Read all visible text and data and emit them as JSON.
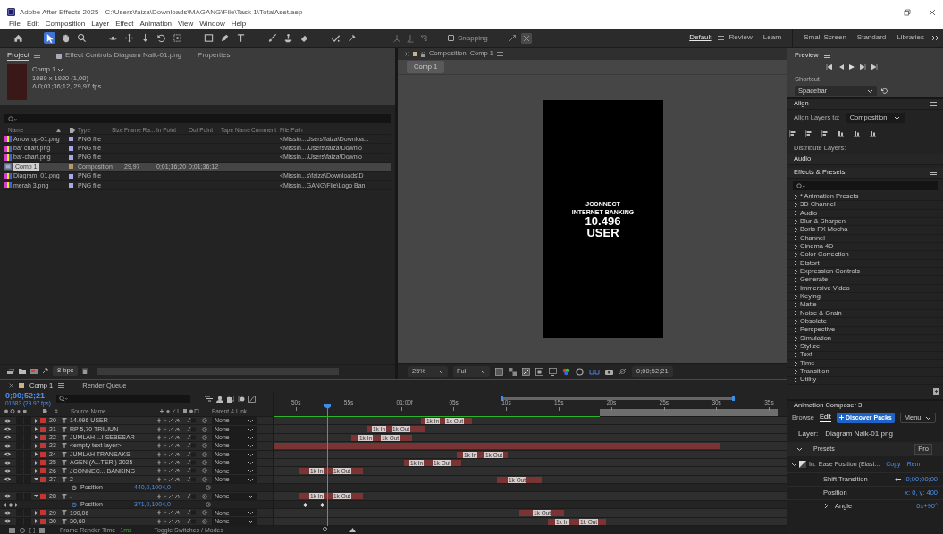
{
  "window": {
    "title": "Adobe After Effects 2025 - C:\\Users\\faiza\\Downloads\\MAGANG\\File\\Task 1\\TotalAset.aep"
  },
  "menu": [
    "File",
    "Edit",
    "Composition",
    "Layer",
    "Effect",
    "Animation",
    "View",
    "Window",
    "Help"
  ],
  "tools": [
    {
      "kind": "home",
      "selected": false
    },
    {
      "kind": "selection",
      "selected": true
    },
    {
      "kind": "hand",
      "selected": false
    },
    {
      "kind": "zoom",
      "selected": false
    },
    {
      "kind": "orbit",
      "selected": false
    },
    {
      "kind": "pan",
      "selected": false
    },
    {
      "kind": "dolly",
      "selected": false
    },
    {
      "kind": "rotate",
      "selected": false
    },
    {
      "kind": "anchor",
      "selected": false
    },
    {
      "kind": "shape",
      "selected": false
    },
    {
      "kind": "pen",
      "selected": false
    },
    {
      "kind": "text",
      "selected": false
    },
    {
      "kind": "brush",
      "selected": false
    },
    {
      "kind": "stamp",
      "selected": false
    },
    {
      "kind": "eraser",
      "selected": false
    },
    {
      "kind": "roto",
      "selected": false
    },
    {
      "kind": "puppet",
      "selected": false
    }
  ],
  "snapping": {
    "label": "Snapping",
    "checked": false
  },
  "workspaces": [
    {
      "label": "Default",
      "selected": true
    },
    {
      "label": "Review",
      "selected": false
    },
    {
      "label": "Learn",
      "selected": false
    },
    {
      "label": "Small Screen",
      "selected": false
    },
    {
      "label": "Standard",
      "selected": false
    },
    {
      "label": "Libraries",
      "selected": false
    }
  ],
  "project_panel": {
    "tabs": [
      {
        "label": "Project",
        "selected": true
      },
      {
        "label": "Effect Controls Diagram Naik-01.png",
        "selected": false
      },
      {
        "label": "Properties",
        "selected": false
      }
    ],
    "comp_name": "Comp 1",
    "comp_size": "1080 x 1920 (1,00)",
    "comp_duration": "Δ 0;01;36;12, 29,97 fps",
    "columns": [
      "Name",
      "Type",
      "Size",
      "Frame Ra...",
      "In Point",
      "Out Point",
      "Tape Name",
      "Comment",
      "File Path"
    ],
    "items": [
      {
        "name": "Arrow up-01.png",
        "kind": "footage",
        "color": "#a9a6e8",
        "type": "PNG file",
        "file_path": "<Missin...Users\\faiza\\Downloa...",
        "selected": false
      },
      {
        "name": "bar chart.png",
        "kind": "footage",
        "color": "#a9a6e8",
        "type": "PNG file",
        "file_path": "<Missin...\\Users\\faiza\\Downlo",
        "selected": false
      },
      {
        "name": "bar-chart.png",
        "kind": "footage",
        "color": "#a9a6e8",
        "type": "PNG file",
        "file_path": "<Missin...\\Users\\faiza\\Downlo",
        "selected": false
      },
      {
        "name": "Comp 1",
        "kind": "composition",
        "color": "#b59a67",
        "type": "Composition",
        "frame_rate": "29,97",
        "in_point": "0;01;16;20",
        "out_point": "0;01;36;12",
        "selected": true
      },
      {
        "name": "Diagram_01.png",
        "kind": "footage",
        "color": "#a9a6e8",
        "type": "PNG file",
        "file_path": "<Missin...s\\faiza\\Downloads\\D",
        "selected": false
      },
      {
        "name": "merah 3.png",
        "kind": "footage",
        "color": "#a9a6e8",
        "type": "PNG file",
        "file_path": "<Missin...GANG\\File\\Logo Ban",
        "selected": false
      }
    ],
    "bit_depth": "8 bpc"
  },
  "composition": {
    "tab": "Composition",
    "tab_comp": "Comp 1",
    "breadcrumb": "Comp 1",
    "canvas_text": [
      {
        "text": "JCONNECT",
        "kind": "small"
      },
      {
        "text": "INTERNET BANKING",
        "kind": "small"
      },
      {
        "text": "10.496",
        "kind": "large"
      },
      {
        "text": "USER",
        "kind": "large"
      }
    ],
    "zoom": "25%",
    "resolution": "Full",
    "timecode": "0;00;52;21"
  },
  "preview": {
    "title": "Preview",
    "shortcut_label": "Shortcut",
    "shortcut": "Spacebar"
  },
  "align": {
    "title": "Align",
    "align_to_label": "Align Layers to:",
    "align_to": "Composition",
    "distribute_label": "Distribute Layers:"
  },
  "audio": {
    "title": "Audio"
  },
  "effects": {
    "title": "Effects & Presets",
    "items": [
      "* Animation Presets",
      "3D Channel",
      "Audio",
      "Blur & Sharpen",
      "Boris FX Mocha",
      "Channel",
      "Cinema 4D",
      "Color Correction",
      "Distort",
      "Expression Controls",
      "Generate",
      "Immersive Video",
      "Keying",
      "Matte",
      "Noise & Grain",
      "Obsolete",
      "Perspective",
      "Simulation",
      "Stylize",
      "Text",
      "Time",
      "Transition",
      "Utility"
    ]
  },
  "animation_composer": {
    "title": "Animation Composer 3",
    "tabs": [
      {
        "label": "Browse",
        "selected": false
      },
      {
        "label": "Edit",
        "selected": true
      }
    ],
    "discover": "Discover Packs",
    "menu": "Menu",
    "layer_label": "Layer:",
    "layer": "Diagram Naik-01.png",
    "presets": "Presets",
    "pro": "Pro",
    "preset": {
      "prefix": "In:",
      "name": "Ease Position (Elast...",
      "copy": "Copy",
      "remove": "Rem"
    },
    "properties": [
      {
        "name": "Shift Transition",
        "value": "0;00;00;00",
        "kind": "time"
      },
      {
        "name": "Position",
        "value": "x: 0, y: 400",
        "kind": "point"
      },
      {
        "name": "Angle",
        "value": "0x+90°",
        "kind": "angle"
      }
    ]
  },
  "timeline": {
    "tabs": [
      {
        "label": "Comp 1",
        "selected": true
      },
      {
        "label": "Render Queue",
        "selected": false
      }
    ],
    "time": "0;00;52;21",
    "frames": "01583 (29.97 fps)",
    "headers": {
      "number": "#",
      "source": "Source Name",
      "parent": "Parent & Link"
    },
    "ruler": [
      "50s",
      "55s",
      "01:00f",
      "05s",
      "10s",
      "15s",
      "20s",
      "25s",
      "30s",
      "35s"
    ],
    "layers": [
      {
        "number": "20",
        "name": "14.096 USER",
        "parent": "None",
        "expanded": false,
        "keyframes": [
          "1k In",
          "1k Out"
        ]
      },
      {
        "number": "21",
        "name": "RP 5,70 TRILIUN",
        "parent": "None",
        "expanded": false,
        "keyframes": [
          "1k In",
          "1k Out"
        ]
      },
      {
        "number": "22",
        "name": "JUMLAH ...I SEBESAR",
        "parent": "None",
        "expanded": false,
        "keyframes": [
          "1k In",
          "1k Out"
        ]
      },
      {
        "number": "23",
        "name": "<empty text layer>",
        "parent": "None",
        "expanded": false
      },
      {
        "number": "24",
        "name": "JUMLAH TRANSAKSI",
        "parent": "None",
        "expanded": false,
        "keyframes": [
          "1k In",
          "1k Out"
        ]
      },
      {
        "number": "25",
        "name": "AGEN (A...TER ) 2025",
        "parent": "None",
        "expanded": false,
        "keyframes": [
          "1k In",
          "1k Out"
        ]
      },
      {
        "number": "26",
        "name": "JCONNEC... BANKING",
        "parent": "None",
        "expanded": false,
        "keyframes": [
          "1k In",
          "1k Out"
        ]
      },
      {
        "number": "27",
        "name": "2",
        "parent": "None",
        "expanded": true,
        "keyframes": [
          "1k Out"
        ],
        "property": {
          "name": "Position",
          "value": "440,0,1004,0",
          "animated": false
        }
      },
      {
        "number": "28",
        "name": ".",
        "parent": "None",
        "expanded": true,
        "keyframes": [
          "1k In",
          "1k Out"
        ],
        "property": {
          "name": "Position",
          "value": "371,0,1004,0",
          "animated": true
        }
      },
      {
        "number": "29",
        "name": "190,06",
        "parent": "None",
        "expanded": false,
        "keyframes": [
          "1k Out"
        ]
      },
      {
        "number": "30",
        "name": "30,60",
        "parent": "None",
        "expanded": false,
        "keyframes": [
          "1k In",
          "1k Out"
        ]
      }
    ],
    "render_time_label": "Frame Render Time",
    "render_time": "1ms",
    "toggle": "Toggle Switches / Modes",
    "zoom_slider": {
      "level": 0.45
    }
  }
}
